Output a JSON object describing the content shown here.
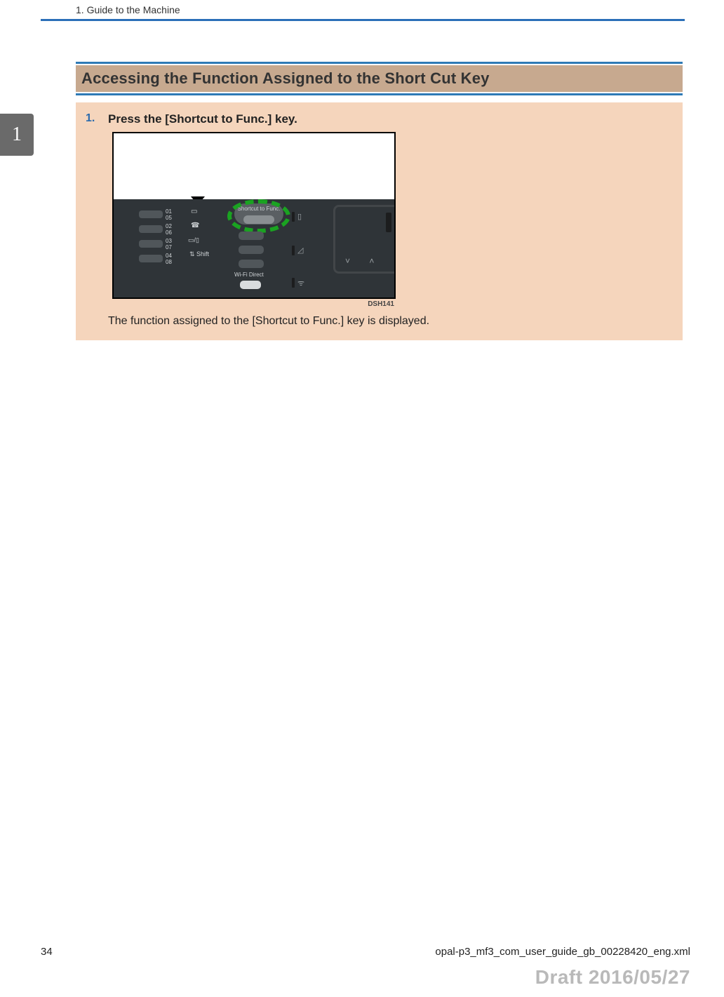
{
  "header": {
    "chapter_line": "1. Guide to the Machine"
  },
  "side_tab_number": "1",
  "section": {
    "title": "Accessing the Function Assigned to the Short Cut Key"
  },
  "steps": [
    {
      "number": "1.",
      "title": "Press the [Shortcut to Func.] key.",
      "result_text": "The function assigned to the [Shortcut to Func.] key is displayed."
    }
  ],
  "illustration": {
    "panel_numbers": [
      "01",
      "05",
      "02",
      "06",
      "03",
      "07",
      "04",
      "08"
    ],
    "shift_label": "Shift",
    "shortcut_label": "Shortcut to Func.",
    "wifi_label": "Wi-Fi Direct",
    "code": "DSH141"
  },
  "footer": {
    "page_number": "34",
    "file_name": "opal-p3_mf3_com_user_guide_gb_00228420_eng.xml"
  },
  "watermark": "Draft 2016/05/27"
}
